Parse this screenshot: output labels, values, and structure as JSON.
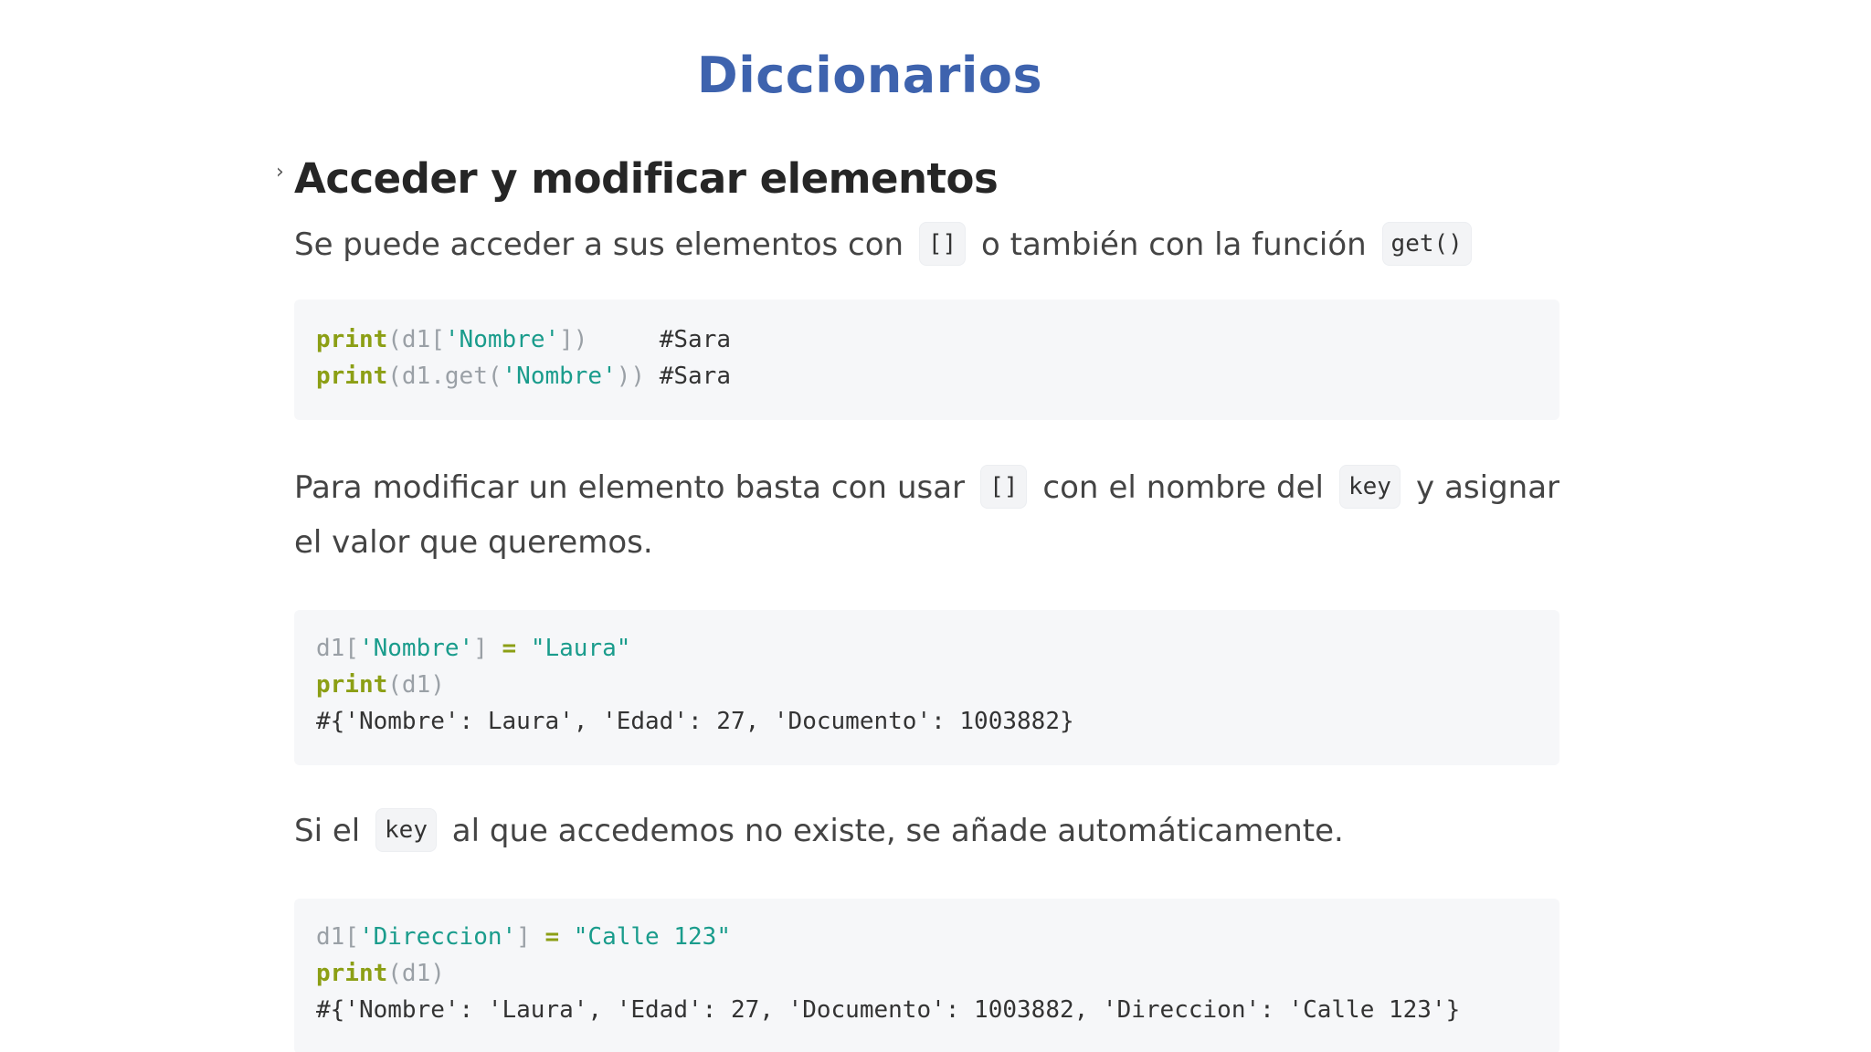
{
  "slide": {
    "title": "Diccionarios"
  },
  "section": {
    "heading": "Acceder y modificar elementos",
    "marker": "›"
  },
  "para1": {
    "t1": "Se puede acceder a sus elementos con",
    "c1": "[]",
    "t2": "o también con la función",
    "c2": "get()"
  },
  "code1": {
    "l1": {
      "fn": "print",
      "a": "(d1[",
      "s": "'Nombre'",
      "b": "])",
      "pad": "     ",
      "cm": "#Sara"
    },
    "l2": {
      "fn": "print",
      "a": "(d1.get(",
      "s": "'Nombre'",
      "b": "))",
      "pad": " ",
      "cm": "#Sara"
    }
  },
  "para2": {
    "t1": "Para modificar un elemento basta con usar",
    "c1": "[]",
    "t2": "con el nombre del",
    "c2": "key",
    "t3": "y asignar el valor que queremos."
  },
  "code2": {
    "l1": {
      "a": "d1[",
      "s": "'Nombre'",
      "b": "] ",
      "op": "=",
      "sp": " ",
      "v": "\"Laura\""
    },
    "l2": {
      "fn": "print",
      "a": "(d1)"
    },
    "l3": {
      "cm": "#{'Nombre': Laura', 'Edad': 27, 'Documento': 1003882}"
    }
  },
  "para3": {
    "t1": "Si el",
    "c1": "key",
    "t2": "al que accedemos no existe, se añade automáticamente."
  },
  "code3": {
    "l1": {
      "a": "d1[",
      "s": "'Direccion'",
      "b": "] ",
      "op": "=",
      "sp": " ",
      "v": "\"Calle 123\""
    },
    "l2": {
      "fn": "print",
      "a": "(d1)"
    },
    "l3": {
      "cm": "#{'Nombre': 'Laura', 'Edad': 27, 'Documento': 1003882, 'Direccion': 'Calle 123'}"
    }
  },
  "colors": {
    "title": "#3e63ae",
    "keyword": "#8c9f15",
    "string": "#1a9c8c",
    "code_bg": "#f6f7f9"
  }
}
